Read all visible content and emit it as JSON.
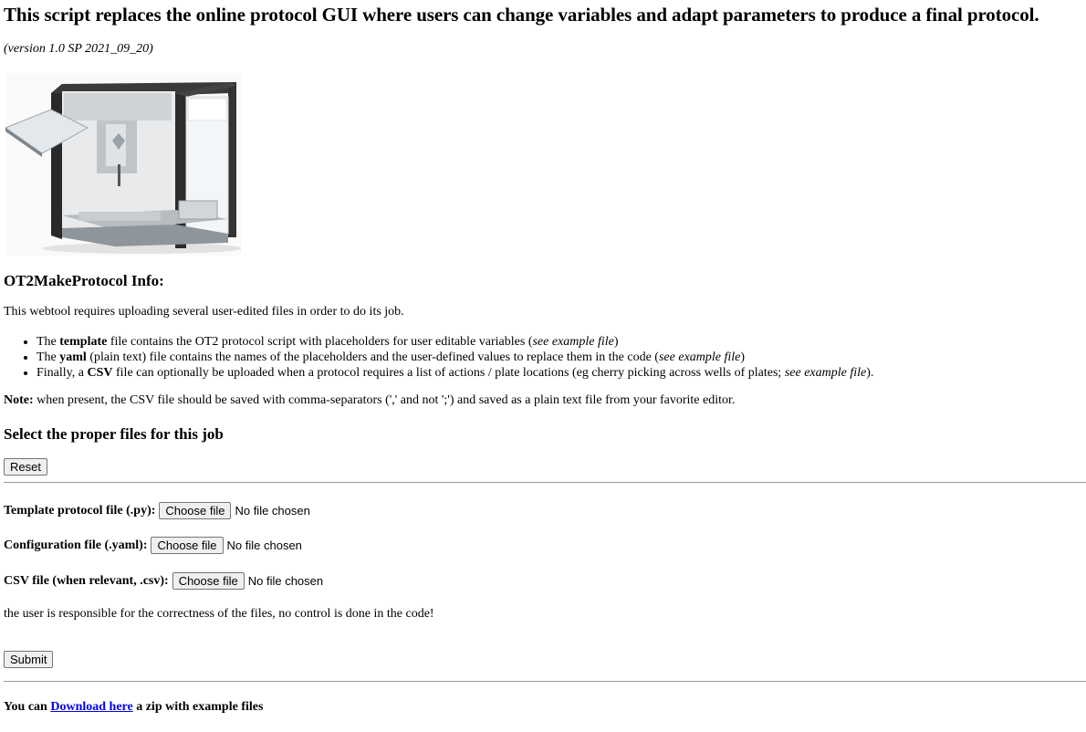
{
  "header": {
    "title": "This script replaces the online protocol GUI where users can change variables and adapt parameters to produce a final protocol.",
    "version": "(version 1.0 SP 2021_09_20)"
  },
  "info": {
    "title": "OT2MakeProtocol Info:",
    "intro": "This webtool requires uploading several user-edited files in order to do its job.",
    "items": [
      {
        "pre": "The ",
        "bold": "template",
        "mid": " file contains the OT2 protocol script with placeholders for user editable variables (",
        "ital": "see example file",
        "post": ")"
      },
      {
        "pre": "The ",
        "bold": "yaml",
        "mid": " (plain text) file contains the names of the placeholders and the user-defined values to replace them in the code (",
        "ital": "see example file",
        "post": ")"
      },
      {
        "pre": "Finally, a ",
        "bold": "CSV",
        "mid": " file can optionally be uploaded when a protocol requires a list of actions / plate locations (eg cherry picking across wells of plates; ",
        "ital": "see example file",
        "post": ")."
      }
    ],
    "note_label": "Note:",
    "note_text": " when present, the CSV file should be saved with comma-separators (',' and not ';') and saved as a plain text file from your favorite editor."
  },
  "form": {
    "title": "Select the proper files for this job",
    "reset_label": "Reset",
    "template_label": "Template protocol file (.py):",
    "config_label": "Configuration file (.yaml):",
    "csv_label": "CSV file (when relevant, .csv):",
    "choose_label": "Choose file",
    "no_file": "No file chosen",
    "disclaimer": "the user is responsible for the correctness of the files, no control is done in the code!",
    "submit_label": "Submit"
  },
  "footer": {
    "pre": "You can ",
    "link": "Download here",
    "post": " a zip with example files"
  }
}
